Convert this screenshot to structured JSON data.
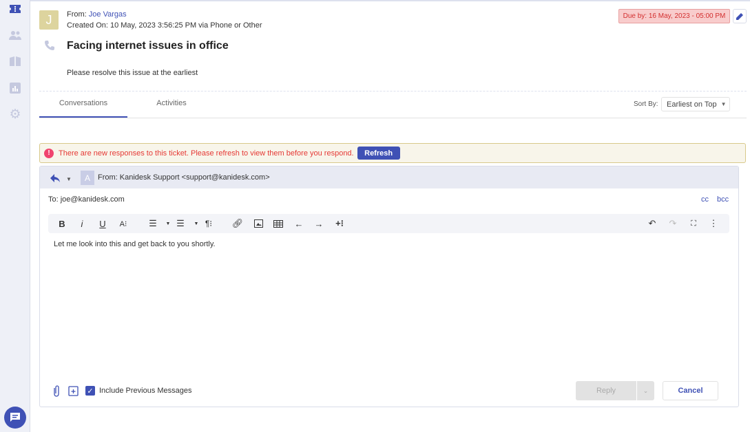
{
  "sidebar": {
    "items": [
      {
        "name": "tickets",
        "icon": "ticket-icon",
        "active": true
      },
      {
        "name": "contacts",
        "icon": "users-icon"
      },
      {
        "name": "knowledge-base",
        "icon": "book-icon"
      },
      {
        "name": "reports",
        "icon": "chart-icon"
      },
      {
        "name": "settings",
        "icon": "gear-icon"
      }
    ],
    "chat_icon": "chat-icon"
  },
  "ticket": {
    "avatar_letter": "J",
    "from_label": "From:",
    "from_name": "Joe Vargas",
    "created": "Created On: 10 May, 2023 3:56:25 PM via Phone or Other",
    "channel_icon": "phone-icon",
    "subject": "Facing internet issues in office",
    "description": "Please resolve this issue at the earliest",
    "due": "Due by: 16 May, 2023 - 05:00 PM"
  },
  "tabs": [
    {
      "label": "Conversations",
      "active": true
    },
    {
      "label": "Activities"
    }
  ],
  "sort": {
    "label": "Sort By:",
    "value": "Earliest on Top"
  },
  "alert": {
    "text": "There are new responses to this ticket. Please refresh to view them before you respond.",
    "button": "Refresh"
  },
  "editor": {
    "from_avatar": "A",
    "from": "From: Kanidesk Support <support@kanidesk.com>",
    "to": "To: joe@kanidesk.com",
    "cc": "cc",
    "bcc": "bcc",
    "body": "Let me look into this and get back to you shortly.",
    "include_previous": "Include Previous Messages",
    "include_previous_checked": true,
    "reply": "Reply",
    "cancel": "Cancel"
  },
  "colors": {
    "accent": "#3f51b5",
    "due_bg": "#f8cccc",
    "due_text": "#d32f2f",
    "alert_bg": "#f8f5ea",
    "alert_text": "#e53935"
  }
}
